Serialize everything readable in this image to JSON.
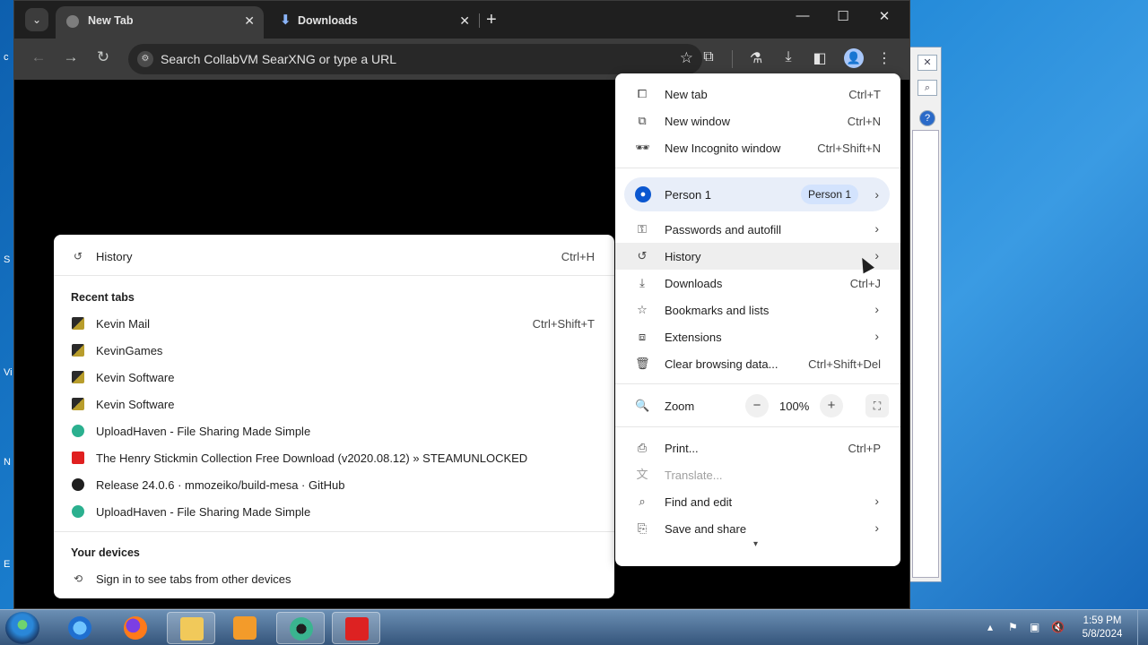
{
  "browser": {
    "tabs": [
      {
        "label": "New Tab",
        "active": true
      },
      {
        "label": "Downloads",
        "active": false
      }
    ],
    "new_tab_glyph": "+",
    "address_placeholder": "Search CollabVM SearXNG or type a URL"
  },
  "main_menu": {
    "items_top": [
      {
        "label": "New tab",
        "shortcut": "Ctrl+T",
        "icon": "new-tab-icon"
      },
      {
        "label": "New window",
        "shortcut": "Ctrl+N",
        "icon": "new-window-icon"
      },
      {
        "label": "New Incognito window",
        "shortcut": "Ctrl+Shift+N",
        "icon": "incognito-icon"
      }
    ],
    "profile": {
      "label": "Person 1",
      "badge": "Person 1"
    },
    "items_mid": [
      {
        "label": "Passwords and autofill",
        "shortcut": "",
        "icon": "key-icon"
      },
      {
        "label": "History",
        "shortcut": "",
        "icon": "history-icon"
      },
      {
        "label": "Downloads",
        "shortcut": "Ctrl+J",
        "icon": "download-icon"
      },
      {
        "label": "Bookmarks and lists",
        "shortcut": "",
        "icon": "star-icon"
      },
      {
        "label": "Extensions",
        "shortcut": "",
        "icon": "puzzle-icon"
      },
      {
        "label": "Clear browsing data...",
        "shortcut": "Ctrl+Shift+Del",
        "icon": "trash-icon"
      }
    ],
    "zoom": {
      "label": "Zoom",
      "value": "100%"
    },
    "items_bottom": [
      {
        "label": "Print...",
        "shortcut": "Ctrl+P",
        "icon": "print-icon"
      },
      {
        "label": "Translate...",
        "shortcut": "",
        "icon": "translate-icon"
      },
      {
        "label": "Find and edit",
        "shortcut": "",
        "icon": "find-icon"
      },
      {
        "label": "Save and share",
        "shortcut": "",
        "icon": "save-icon"
      }
    ]
  },
  "history_submenu": {
    "history": {
      "label": "History",
      "shortcut": "Ctrl+H"
    },
    "recent_tabs_title": "Recent tabs",
    "recent_tabs": [
      {
        "label": "Kevin Mail",
        "shortcut": "Ctrl+Shift+T"
      },
      {
        "label": "KevinGames",
        "shortcut": ""
      },
      {
        "label": "Kevin Software",
        "shortcut": ""
      },
      {
        "label": "Kevin Software",
        "shortcut": ""
      },
      {
        "label": "UploadHaven - File Sharing Made Simple",
        "shortcut": ""
      },
      {
        "label": "The Henry Stickmin Collection Free Download (v2020.08.12) » STEAMUNLOCKED",
        "shortcut": ""
      },
      {
        "label": "Release 24.0.6 · mmozeiko/build-mesa · GitHub",
        "shortcut": ""
      },
      {
        "label": "UploadHaven - File Sharing Made Simple",
        "shortcut": ""
      }
    ],
    "your_devices_title": "Your devices",
    "sign_in": "Sign in to see tabs from other devices"
  },
  "taskbar": {
    "time": "1:59 PM",
    "date": "5/8/2024"
  }
}
